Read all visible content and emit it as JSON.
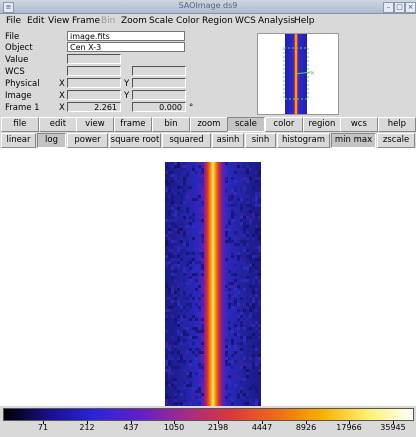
{
  "window": {
    "title": "SAOImage ds9"
  },
  "menu": [
    {
      "label": "File",
      "enabled": true
    },
    {
      "label": "Edit",
      "enabled": true
    },
    {
      "label": "View",
      "enabled": true
    },
    {
      "label": "Frame",
      "enabled": true
    },
    {
      "label": "Bin",
      "enabled": false
    },
    {
      "label": "Zoom",
      "enabled": true
    },
    {
      "label": "Scale",
      "enabled": true
    },
    {
      "label": "Color",
      "enabled": true
    },
    {
      "label": "Region",
      "enabled": true
    },
    {
      "label": "WCS",
      "enabled": true
    },
    {
      "label": "Analysis",
      "enabled": true
    },
    {
      "label": "Help",
      "enabled": true
    }
  ],
  "info": {
    "file_label": "File",
    "file_value": "image.fits",
    "object_label": "Object",
    "object_value": "Cen X-3",
    "value_label": "Value",
    "value_value": "",
    "wcs_label": "WCS",
    "wcs_value": "",
    "physical_label": "Physical",
    "physical_x": "",
    "physical_y": "",
    "image_label": "Image",
    "image_x": "",
    "image_y": "",
    "frame_label": "Frame 1",
    "zoom_value": "2.261",
    "angle_value": "0.000",
    "x_label": "X",
    "y_label": "Y",
    "degree_symbol": "°"
  },
  "buttonbar": [
    {
      "label": "file",
      "active": false
    },
    {
      "label": "edit",
      "active": false
    },
    {
      "label": "view",
      "active": false
    },
    {
      "label": "frame",
      "active": false
    },
    {
      "label": "bin",
      "active": false
    },
    {
      "label": "zoom",
      "active": false
    },
    {
      "label": "scale",
      "active": true
    },
    {
      "label": "color",
      "active": false
    },
    {
      "label": "region",
      "active": false
    },
    {
      "label": "wcs",
      "active": false
    },
    {
      "label": "help",
      "active": false
    }
  ],
  "scalebar": [
    {
      "label": "linear",
      "active": false
    },
    {
      "label": "log",
      "active": true
    },
    {
      "label": "power",
      "active": false
    },
    {
      "label": "square root",
      "active": false
    },
    {
      "label": "squared",
      "active": false
    },
    {
      "label": "asinh",
      "active": false
    },
    {
      "label": "sinh",
      "active": false
    },
    {
      "label": "histogram",
      "active": false
    },
    {
      "label": "min max",
      "active": true
    },
    {
      "label": "zscale",
      "active": false
    }
  ],
  "colorbar": {
    "ticks": [
      "71",
      "212",
      "437",
      "1050",
      "2198",
      "4447",
      "8926",
      "17966",
      "35945"
    ],
    "colors": [
      "#000000",
      "#1a0f8c",
      "#2a25d8",
      "#6020c8",
      "#a52a88",
      "#d83a3a",
      "#f06a18",
      "#f8b000",
      "#fff070",
      "#ffffff"
    ]
  },
  "theme": {
    "accent": "#d9d9d9"
  }
}
